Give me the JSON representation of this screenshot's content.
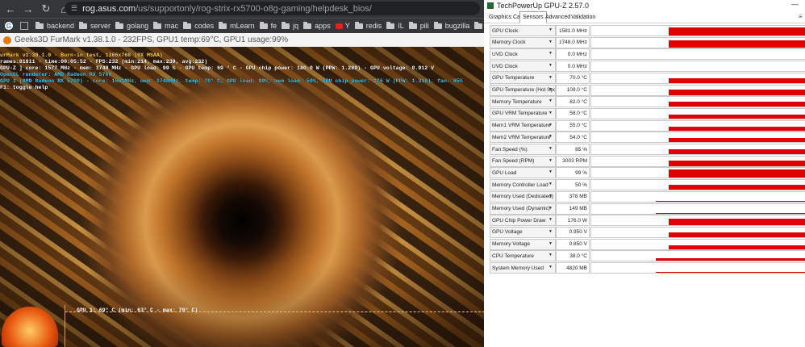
{
  "browser": {
    "url_host": "rog.asus.com",
    "url_path": "/us/supportonly/rog-strix-rx5700-o8g-gaming/helpdesk_bios/",
    "nav_icons": [
      "back-icon",
      "forward-icon",
      "reload-icon",
      "home-icon"
    ],
    "bookmarks": [
      {
        "label": "G",
        "type": "google"
      },
      {
        "label": "",
        "type": "grid"
      },
      {
        "label": "backend",
        "type": "folder"
      },
      {
        "label": "server",
        "type": "folder"
      },
      {
        "label": "golang",
        "type": "folder"
      },
      {
        "label": "mac",
        "type": "folder"
      },
      {
        "label": "codes",
        "type": "folder"
      },
      {
        "label": "mLearn",
        "type": "folder"
      },
      {
        "label": "fe",
        "type": "folder"
      },
      {
        "label": "jq",
        "type": "folder"
      },
      {
        "label": "apps",
        "type": "folder"
      },
      {
        "label": "Y",
        "type": "youtube"
      },
      {
        "label": "redis",
        "type": "folder"
      },
      {
        "label": "IL",
        "type": "folder"
      },
      {
        "label": "pili",
        "type": "folder"
      },
      {
        "label": "bugzilla",
        "type": "folder"
      },
      {
        "label": "fr",
        "type": "folder"
      }
    ]
  },
  "furmark": {
    "window_title": "Geeks3D FurMark v1.38.1.0 - 232FPS, GPU1 temp:69°C, GPU1 usage:99%",
    "overlay": [
      {
        "text": "urMark v1.38.1.0 - Burn-in test, 1366x768 (0X MSAA)",
        "color": "#ffd23f"
      },
      {
        "text": "rames:81911 - time:00:05:52 - FPS:232 (min:214, max:239, avg:232)",
        "color": "#ffffff"
      },
      {
        "text": "GPU-Z ] core: 1577 MHz - mem: 1748 MHz - GPU load: 99 % - GPU temp: 69 ° C - GPU chip power: 180.0 W (PPW: 1.289) - GPU voltage: 0.912 V",
        "color": "#ffffff"
      },
      {
        "text": "OpenGL renderer: AMD Radeon RX 5700",
        "color": "#47c7e8"
      },
      {
        "text": "GPU 1 (AMD Radeon RX 5700) - core: 1581MHz, mem: 1748MHz, temp: 70° C, GPU load: 99%, mem load: 50%, GPU chip power: 176 W (PPW: 1.318), fan: 85%",
        "color": "#47c7e8"
      },
      {
        "text": "F1: toggle help",
        "color": "#ffffff"
      }
    ],
    "temp_graph_label": "GPU 1: 69° C (min: 63° C - max: 70° C)"
  },
  "gpuz": {
    "title": "TechPowerUp GPU-Z 2.57.0",
    "tabs": [
      "Graphics Card",
      "Sensors",
      "Advanced",
      "Validation"
    ],
    "active_tab": "Sensors",
    "accent_color": "#e00000",
    "sensors": [
      {
        "name": "GPU Clock",
        "value": "1581.0 MHz",
        "level": 0.9
      },
      {
        "name": "Memory Clock",
        "value": "1748.0 MHz",
        "level": 0.85
      },
      {
        "name": "UVD Clock",
        "value": "0.0 MHz",
        "level": 0
      },
      {
        "name": "UVD Clock",
        "value": "0.0 MHz",
        "level": 0
      },
      {
        "name": "GPU Temperature",
        "value": "70.0 °C",
        "level": 0.55
      },
      {
        "name": "GPU Temperature (Hot Spot)",
        "value": "109.0 °C",
        "level": 0.6
      },
      {
        "name": "Memory Temperature",
        "value": "82.0 °C",
        "level": 0.5
      },
      {
        "name": "GPU VRM Temperature",
        "value": "58.0 °C",
        "level": 0.45
      },
      {
        "name": "Mem1 VRM Temperature",
        "value": "55.0 °C",
        "level": 0.45
      },
      {
        "name": "Mem2 VRM Temperature",
        "value": "54.0 °C",
        "level": 0.45
      },
      {
        "name": "Fan Speed (%)",
        "value": "85 %",
        "level": 0.55
      },
      {
        "name": "Fan Speed (RPM)",
        "value": "3003 RPM",
        "level": 0.6
      },
      {
        "name": "GPU Load",
        "value": "99 %",
        "level": 0.9
      },
      {
        "name": "Memory Controller Load",
        "value": "50 %",
        "level": 0.55
      },
      {
        "name": "Memory Used (Dedicated)",
        "value": "378 MB",
        "level": 0.1
      },
      {
        "name": "Memory Used (Dynamic)",
        "value": "149 MB",
        "level": 0.05
      },
      {
        "name": "GPU Chip Power Draw",
        "value": "176.0 W",
        "level": 0.7
      },
      {
        "name": "GPU Voltage",
        "value": "0.950 V",
        "level": 0.5
      },
      {
        "name": "Memory Voltage",
        "value": "0.850 V",
        "level": 0.45
      },
      {
        "name": "CPU Temperature",
        "value": "38.0 °C",
        "level": 0.3
      },
      {
        "name": "System Memory Used",
        "value": "4820 MB",
        "level": 0.1
      }
    ]
  }
}
